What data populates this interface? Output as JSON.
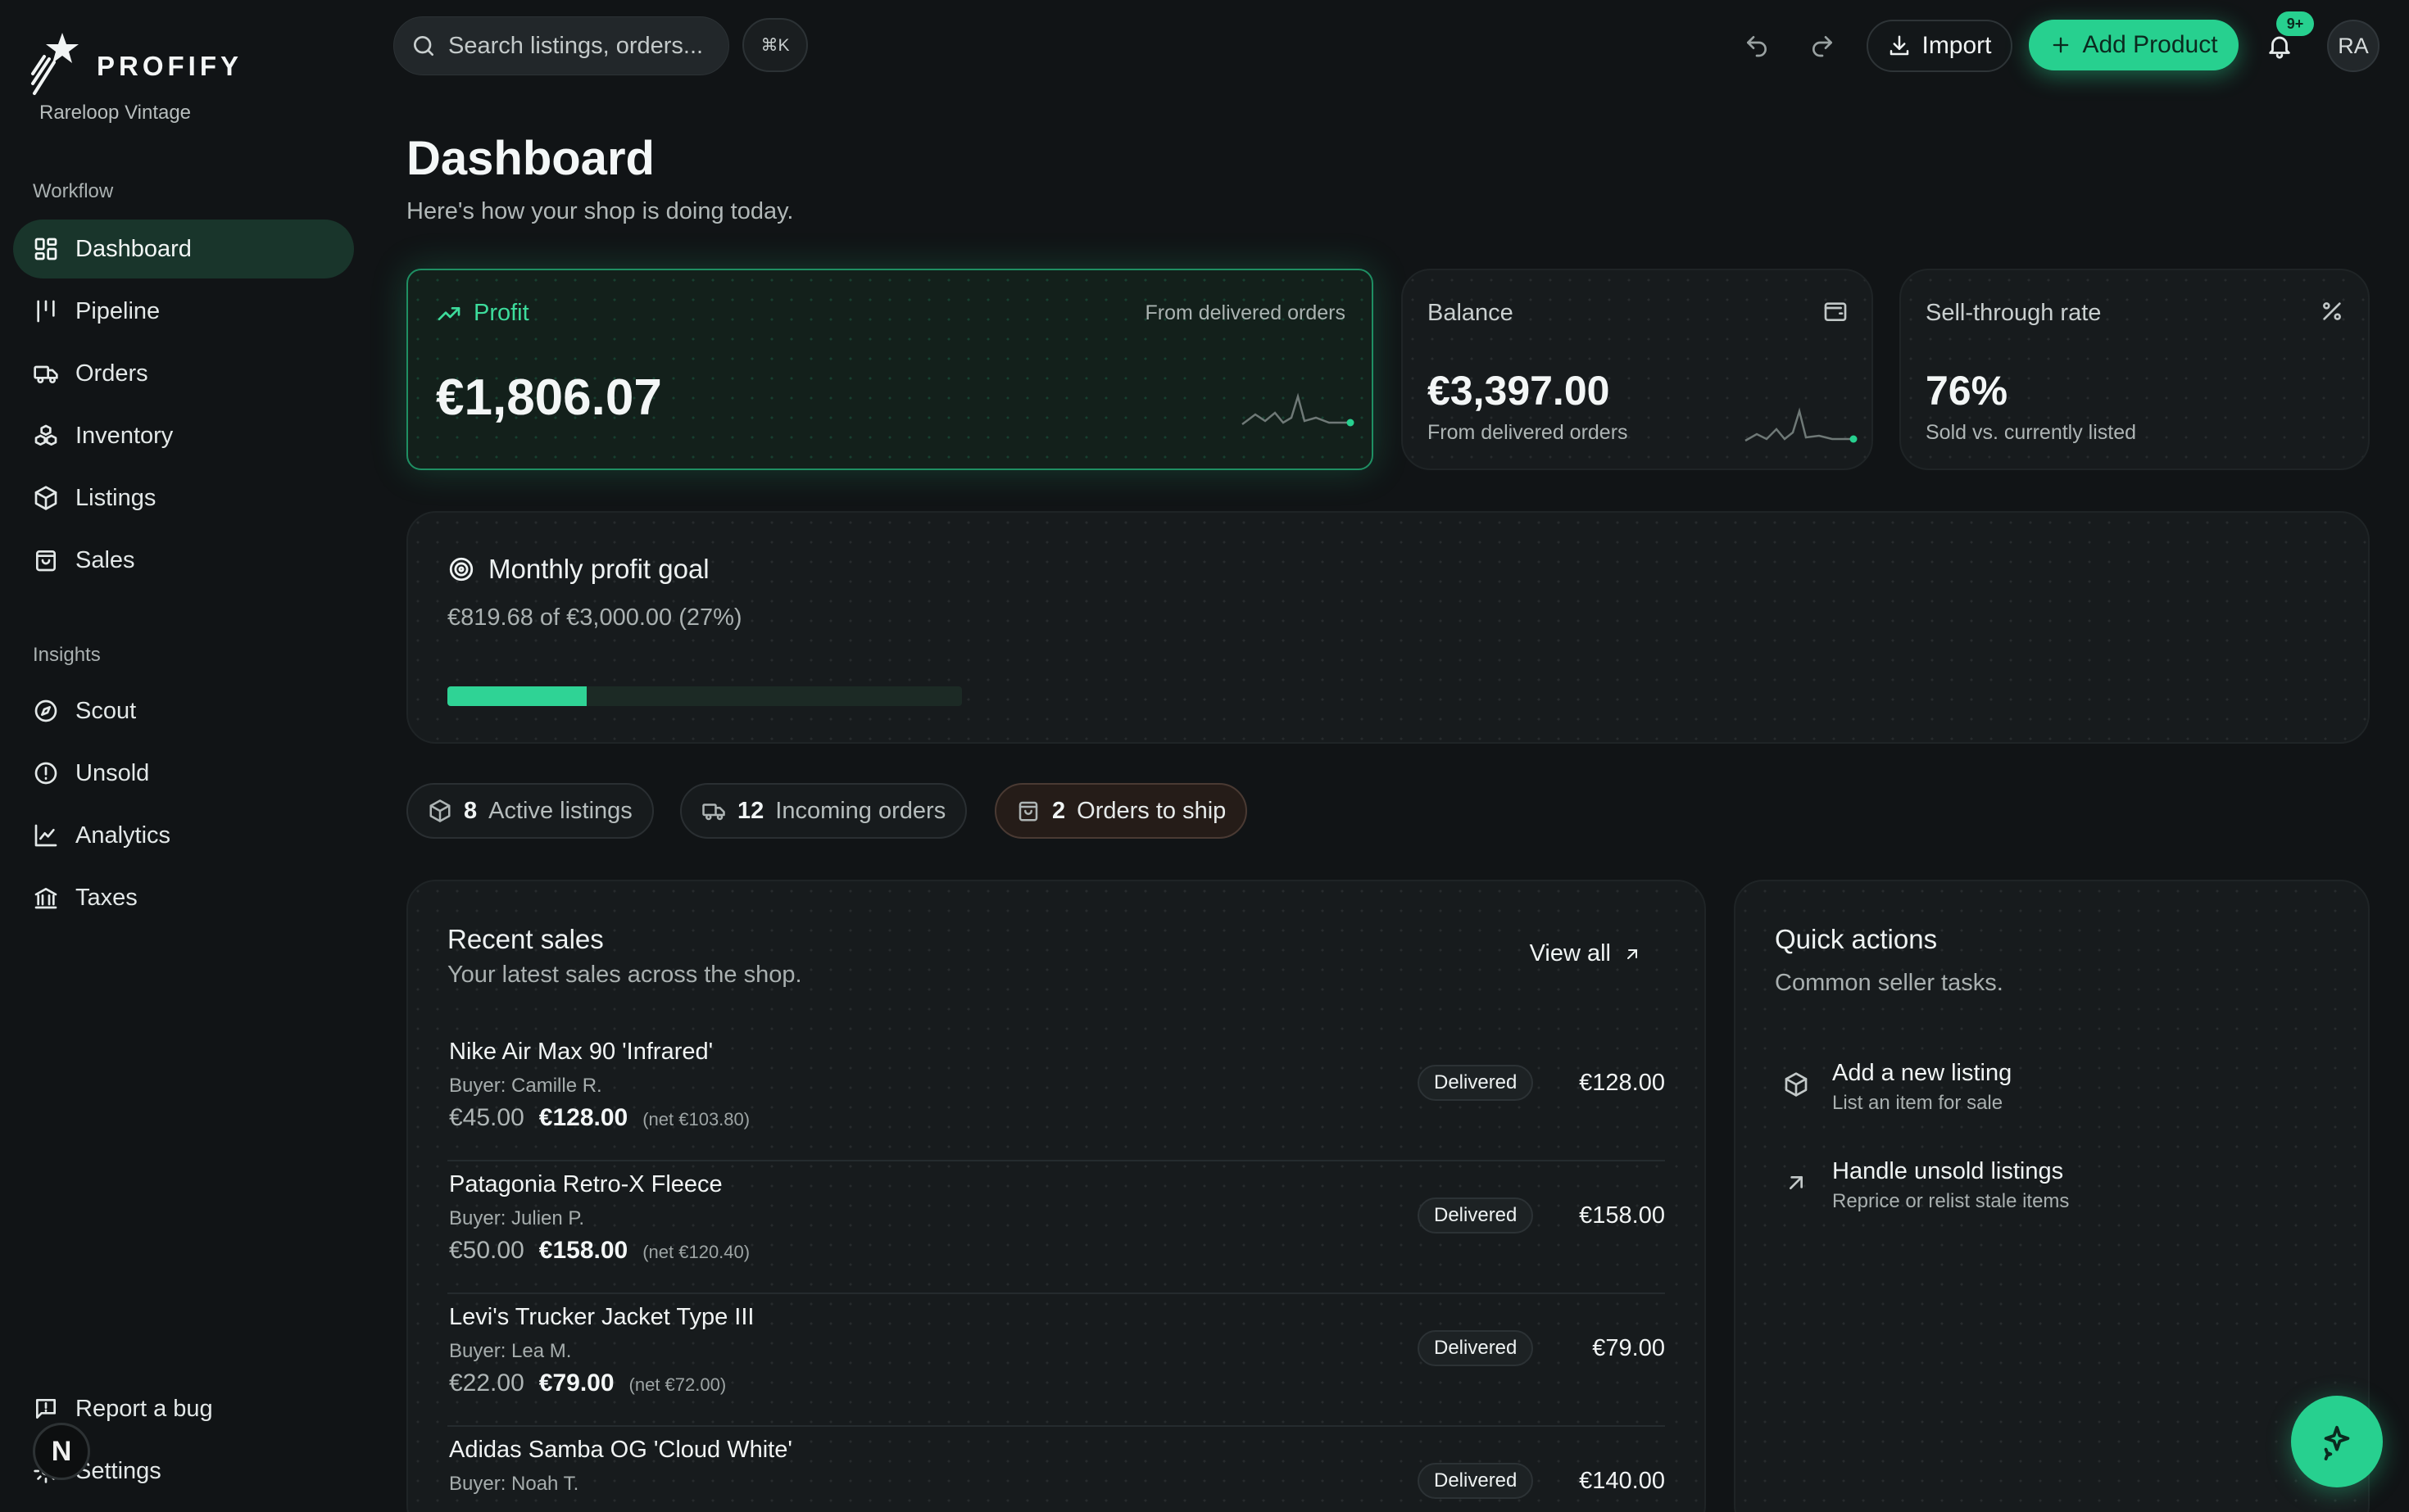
{
  "brand": {
    "name": "PROFIFY",
    "shop": "Rareloop Vintage"
  },
  "sidebar": {
    "workflow_title": "Workflow",
    "workflow": [
      {
        "label": "Dashboard",
        "icon": "dashboard-icon",
        "active": true
      },
      {
        "label": "Pipeline",
        "icon": "pipeline-icon"
      },
      {
        "label": "Orders",
        "icon": "truck-icon"
      },
      {
        "label": "Inventory",
        "icon": "boxes-icon"
      },
      {
        "label": "Listings",
        "icon": "package-icon"
      },
      {
        "label": "Sales",
        "icon": "bag-icon"
      }
    ],
    "insights_title": "Insights",
    "insights": [
      {
        "label": "Scout",
        "icon": "compass-icon"
      },
      {
        "label": "Unsold",
        "icon": "alert-circle-icon"
      },
      {
        "label": "Analytics",
        "icon": "chart-line-icon"
      },
      {
        "label": "Taxes",
        "icon": "bank-icon"
      }
    ],
    "footer": [
      {
        "label": "Report a bug",
        "icon": "report-icon"
      },
      {
        "label": "Settings",
        "icon": "gear-icon"
      }
    ],
    "help_letter": "N"
  },
  "topbar": {
    "search_placeholder": "Search listings, orders...",
    "shortcut": "⌘K",
    "import_label": "Import",
    "add_label": "Add Product",
    "notifications_badge": "9+",
    "avatar_initials": "RA"
  },
  "header": {
    "title": "Dashboard",
    "subtitle": "Here's how your shop is doing today."
  },
  "stats": {
    "profit": {
      "label": "Profit",
      "note": "From delivered orders",
      "value": "€1,806.07"
    },
    "balance": {
      "label": "Balance",
      "value": "€3,397.00",
      "sub": "From delivered orders"
    },
    "sell_through": {
      "label": "Sell-through rate",
      "value": "76%",
      "sub": "Sold vs. currently listed"
    }
  },
  "goal": {
    "title": "Monthly profit goal",
    "summary": "€819.68 of €3,000.00 (27%)",
    "progress": 0.27
  },
  "pills": [
    {
      "count": "8",
      "label": "Active listings",
      "icon": "package-icon"
    },
    {
      "count": "12",
      "label": "Incoming orders",
      "icon": "truck-icon"
    },
    {
      "count": "2",
      "label": "Orders to ship",
      "icon": "bag-icon"
    }
  ],
  "recent_sales": {
    "title": "Recent sales",
    "subtitle": "Your latest sales across the shop.",
    "view_all": "View all",
    "rows": [
      {
        "name": "Nike Air Max 90 'Infrared'",
        "buyer": "Buyer: Camille R.",
        "cost": "€45.00",
        "price": "€128.00",
        "net": "(net €103.80)",
        "status": "Delivered",
        "amount": "€128.00"
      },
      {
        "name": "Patagonia Retro-X Fleece",
        "buyer": "Buyer: Julien P.",
        "cost": "€50.00",
        "price": "€158.00",
        "net": "(net €120.40)",
        "status": "Delivered",
        "amount": "€158.00"
      },
      {
        "name": "Levi's Trucker Jacket Type III",
        "buyer": "Buyer: Lea M.",
        "cost": "€22.00",
        "price": "€79.00",
        "net": "(net €72.00)",
        "status": "Delivered",
        "amount": "€79.00"
      },
      {
        "name": "Adidas Samba OG 'Cloud White'",
        "buyer": "Buyer: Noah T.",
        "cost": "",
        "price": "",
        "net": "",
        "status": "Delivered",
        "amount": "€140.00"
      }
    ]
  },
  "quick_actions": {
    "title": "Quick actions",
    "subtitle": "Common seller tasks.",
    "items": [
      {
        "title": "Add a new listing",
        "sub": "List an item for sale",
        "icon": "package-icon"
      },
      {
        "title": "Handle unsold listings",
        "sub": "Reprice or relist stale items",
        "icon": "arrow-up-right-icon"
      }
    ]
  },
  "colors": {
    "accent": "#27d08f",
    "background": "#111416",
    "card": "#171b1d",
    "active_nav": "#19352b"
  }
}
